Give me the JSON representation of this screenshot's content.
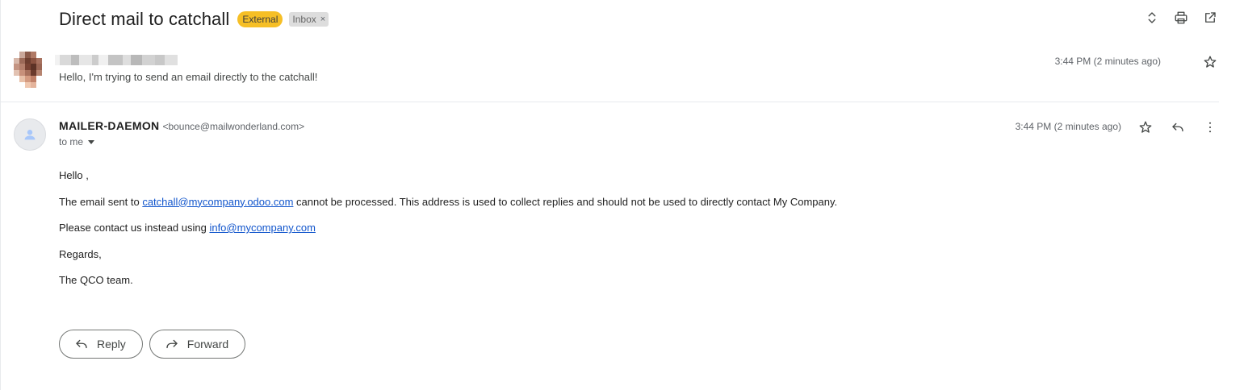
{
  "thread": {
    "subject": "Direct mail to catchall",
    "labels": {
      "external": "External",
      "inbox": "Inbox",
      "remove_glyph": "×"
    }
  },
  "top_actions": [
    "expand-collapse-icon",
    "print-icon",
    "open-in-new-window-icon"
  ],
  "messages": [
    {
      "sender_name": "",
      "snippet": "Hello, I'm trying to send an email directly to the catchall!",
      "time": "3:44 PM (2 minutes ago)"
    },
    {
      "sender_name": "MAILER-DAEMON",
      "sender_email": "<bounce@mailwonderland.com>",
      "recipient": "to me",
      "time": "3:44 PM (2 minutes ago)",
      "body": {
        "greeting": "Hello ,",
        "line1_before": "The email sent to ",
        "line1_link": "catchall@mycompany.odoo.com",
        "line1_after": " cannot be processed. This address is used to collect replies and should not be used to directly contact My Company.",
        "line2_before": "Please contact us instead using ",
        "line2_link": "info@mycompany.com",
        "regards": "Regards,",
        "signature": "The QCO team."
      }
    }
  ],
  "footer_buttons": {
    "reply": "Reply",
    "forward": "Forward"
  },
  "colors": {
    "external_badge": "#f6bf26",
    "inbox_badge": "#dddddd",
    "link": "#1155cc",
    "divider": "#e8eaed"
  }
}
